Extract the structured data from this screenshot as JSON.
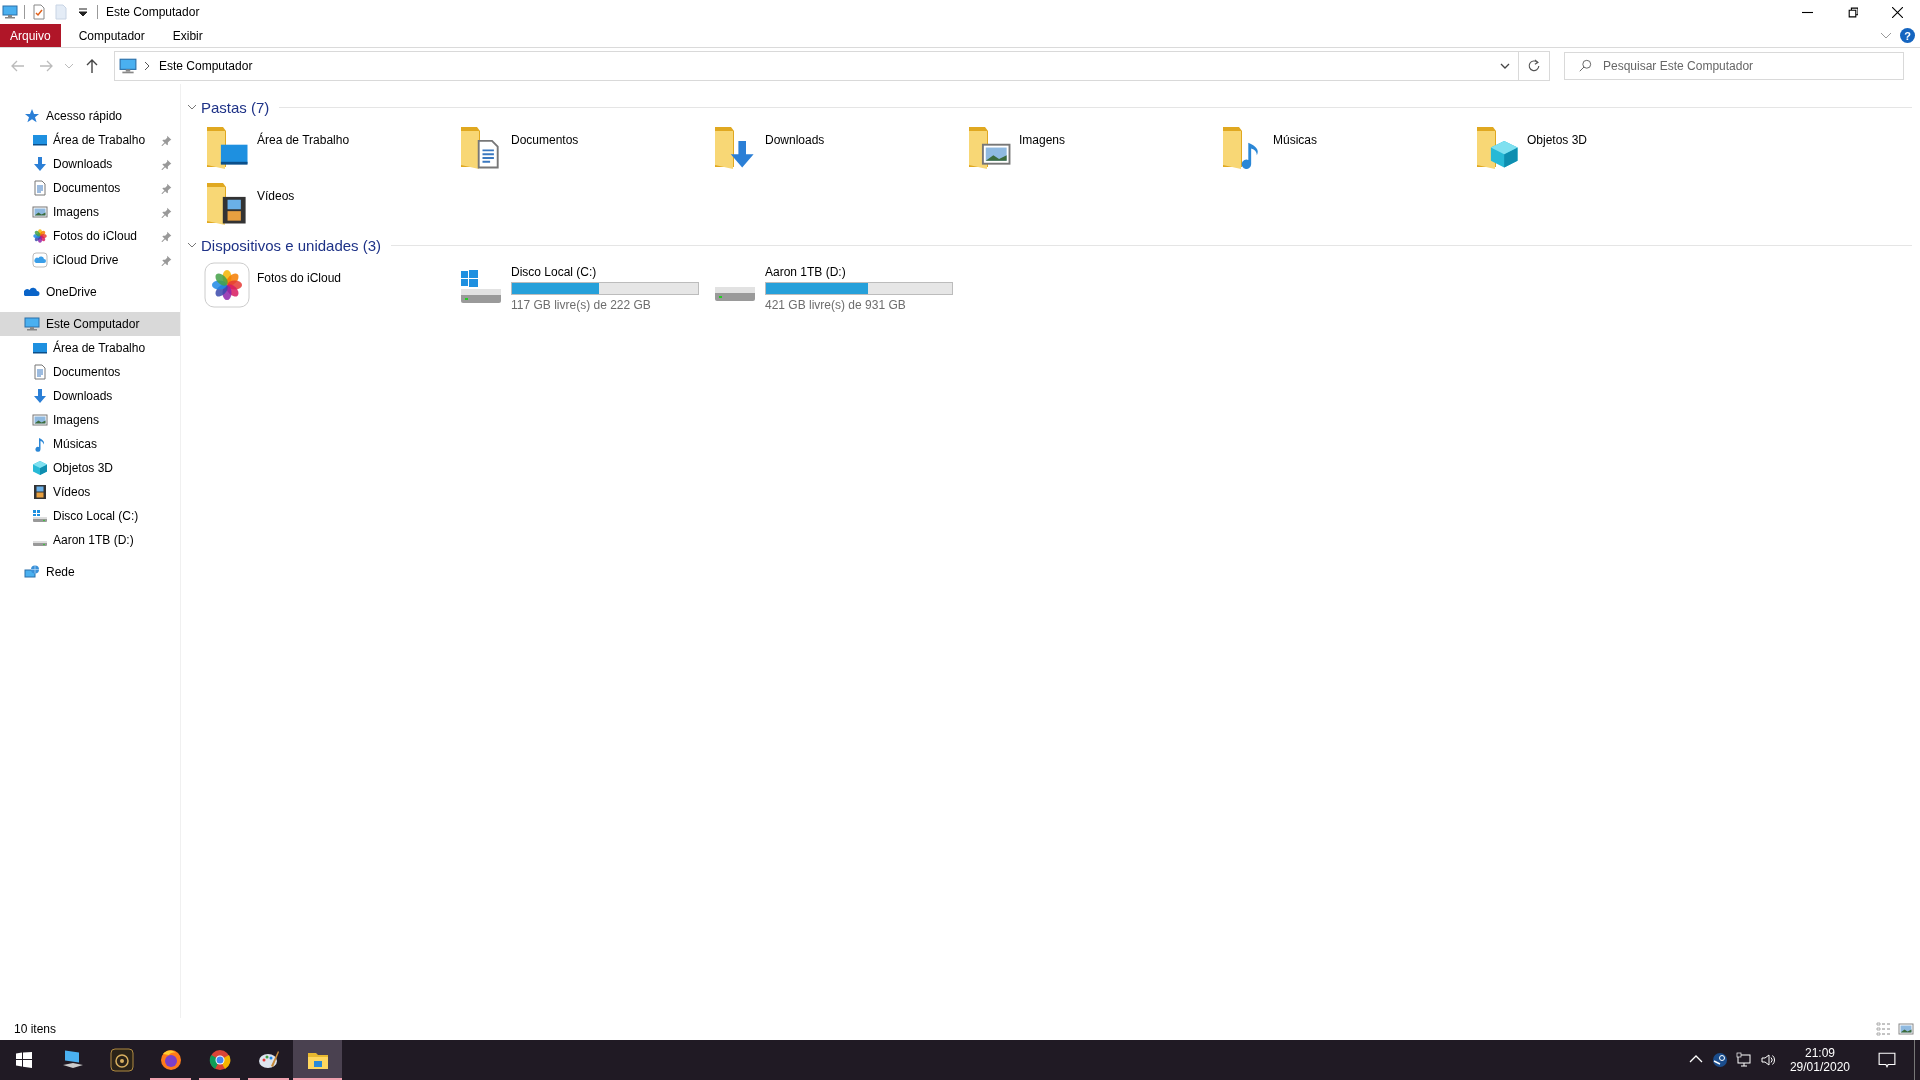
{
  "window": {
    "title": "Este Computador"
  },
  "ribbon": {
    "tabs": [
      {
        "label": "Arquivo",
        "kind": "file"
      },
      {
        "label": "Computador",
        "kind": "tab"
      },
      {
        "label": "Exibir",
        "kind": "tab"
      }
    ],
    "help": "?"
  },
  "address_bar": {
    "path": "Este Computador"
  },
  "search": {
    "placeholder": "Pesquisar Este Computador"
  },
  "sidebar": {
    "items": [
      {
        "label": "Acesso rápido",
        "kind": "star",
        "selected": false,
        "children": [
          {
            "label": "Área de Trabalho",
            "kind": "desktop",
            "pinned": true,
            "selected": false
          },
          {
            "label": "Downloads",
            "kind": "downloads",
            "pinned": true,
            "selected": false
          },
          {
            "label": "Documentos",
            "kind": "documents",
            "pinned": true,
            "selected": false
          },
          {
            "label": "Imagens",
            "kind": "pictures",
            "pinned": true,
            "selected": false
          },
          {
            "label": "Fotos do iCloud",
            "kind": "photos",
            "pinned": true,
            "selected": false
          },
          {
            "label": "iCloud Drive",
            "kind": "icloud",
            "pinned": true,
            "selected": false
          }
        ]
      },
      {
        "label": "OneDrive",
        "kind": "cloud",
        "selected": false
      },
      {
        "label": "Este Computador",
        "kind": "computer",
        "selected": true,
        "children": [
          {
            "label": "Área de Trabalho",
            "kind": "desktop",
            "pinned": false,
            "selected": false
          },
          {
            "label": "Documentos",
            "kind": "documents",
            "pinned": false,
            "selected": false
          },
          {
            "label": "Downloads",
            "kind": "downloads",
            "pinned": false,
            "selected": false
          },
          {
            "label": "Imagens",
            "kind": "pictures",
            "pinned": false,
            "selected": false
          },
          {
            "label": "Músicas",
            "kind": "music",
            "pinned": false,
            "selected": false
          },
          {
            "label": "Objetos 3D",
            "kind": "cube",
            "pinned": false,
            "selected": false
          },
          {
            "label": "Vídeos",
            "kind": "videos",
            "pinned": false,
            "selected": false
          },
          {
            "label": "Disco Local (C:)",
            "kind": "system-drive",
            "pinned": false,
            "selected": false
          },
          {
            "label": "Aaron 1TB (D:)",
            "kind": "drive",
            "pinned": false,
            "selected": false
          }
        ]
      },
      {
        "label": "Rede",
        "kind": "network",
        "selected": false
      }
    ]
  },
  "groups": [
    {
      "title": "Pastas (7)",
      "items": [
        {
          "name": "Área de Trabalho",
          "kind": "desktop"
        },
        {
          "name": "Documentos",
          "kind": "documents"
        },
        {
          "name": "Downloads",
          "kind": "downloads"
        },
        {
          "name": "Imagens",
          "kind": "pictures"
        },
        {
          "name": "Músicas",
          "kind": "music"
        },
        {
          "name": "Objetos 3D",
          "kind": "cube"
        },
        {
          "name": "Vídeos",
          "kind": "videos"
        }
      ]
    },
    {
      "title": "Dispositivos e unidades (3)",
      "items": [
        {
          "name": "Fotos do iCloud",
          "kind": "photos"
        },
        {
          "name": "Disco Local (C:)",
          "kind": "system-drive",
          "level": 0.47,
          "space": "117 GB livre(s) de 222 GB"
        },
        {
          "name": "Aaron 1TB (D:)",
          "kind": "drive",
          "level": 0.55,
          "space": "421 GB livre(s) de 931 GB"
        }
      ]
    }
  ],
  "status_bar": {
    "count": "10 itens"
  },
  "taskbar": {
    "apps": [
      {
        "kind": "computer",
        "running": false,
        "selected": false
      },
      {
        "kind": "audio",
        "running": false,
        "selected": false
      },
      {
        "kind": "firefox",
        "running": true,
        "selected": false
      },
      {
        "kind": "chrome",
        "running": true,
        "selected": false
      },
      {
        "kind": "paint",
        "running": true,
        "selected": false
      },
      {
        "kind": "explorer",
        "running": true,
        "selected": true
      }
    ],
    "time": "21:09",
    "date": "29/01/2020"
  }
}
